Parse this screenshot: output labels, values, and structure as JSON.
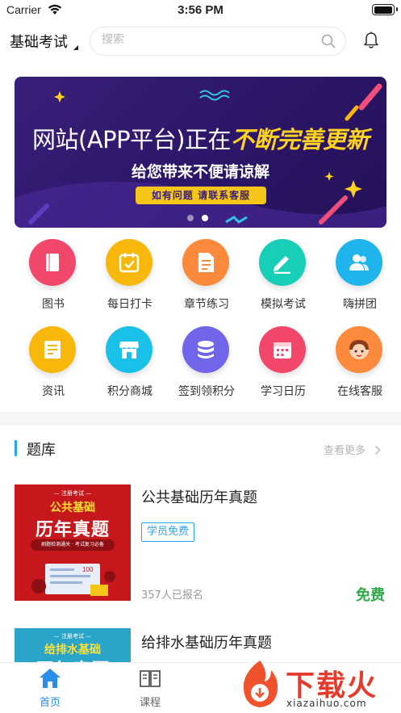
{
  "status_bar": {
    "carrier": "Carrier",
    "time": "3:56 PM",
    "battery_level": 1.0
  },
  "header": {
    "exam_select": "基础考试",
    "search_placeholder": "搜索"
  },
  "banner": {
    "line1_prefix": "网站(APP平台)正在",
    "line1_highlight": "不断完善更新",
    "line2": "给您带来不便请谅解",
    "tag": "如有问题 请联系客服",
    "page_count": 2,
    "active_page": 2
  },
  "grid": [
    {
      "label": "图书",
      "icon": "book-icon",
      "color": "#f1476a"
    },
    {
      "label": "每日打卡",
      "icon": "calendar-check-icon",
      "color": "#f8b70b"
    },
    {
      "label": "章节练习",
      "icon": "document-icon",
      "color": "#fb8a3c"
    },
    {
      "label": "模拟考试",
      "icon": "pencil-icon",
      "color": "#16cfb6"
    },
    {
      "label": "嗨拼团",
      "icon": "group-icon",
      "color": "#1fb4ec"
    },
    {
      "label": "资讯",
      "icon": "news-icon",
      "color": "#f8b70b"
    },
    {
      "label": "积分商城",
      "icon": "store-icon",
      "color": "#19c0e8"
    },
    {
      "label": "签到领积分",
      "icon": "coins-icon",
      "color": "#7166ea"
    },
    {
      "label": "学习日历",
      "icon": "calendar-icon",
      "color": "#f1476a"
    },
    {
      "label": "在线客服",
      "icon": "support-agent-icon",
      "color": "#fb8a3c"
    }
  ],
  "section": {
    "title": "题库",
    "more": "查看更多"
  },
  "cards": [
    {
      "title": "公共基础历年真题",
      "badge": "学员免费",
      "enrolled": "357人已报名",
      "price": "免费",
      "cover": {
        "top": "— 注册考试 —",
        "mid": "公共基础",
        "big": "历年真题",
        "pill": "刷题检测通关 · 考试复习必备"
      }
    },
    {
      "title": "给排水基础历年真题",
      "cover": {
        "top": "— 注册考试 —",
        "mid": "给排水基础",
        "big": "历年真题"
      }
    }
  ],
  "tabbar": [
    {
      "label": "首页",
      "icon": "home-icon",
      "active": true
    },
    {
      "label": "课程",
      "icon": "book-open-icon",
      "active": false
    }
  ],
  "watermark": {
    "text": "下载火",
    "url": "xiazaihuo.com"
  },
  "colors": {
    "accent": "#2aa6e8",
    "free_green": "#2ea94a",
    "tab_active": "#2a8de8",
    "banner_bg": "#2c1668"
  }
}
